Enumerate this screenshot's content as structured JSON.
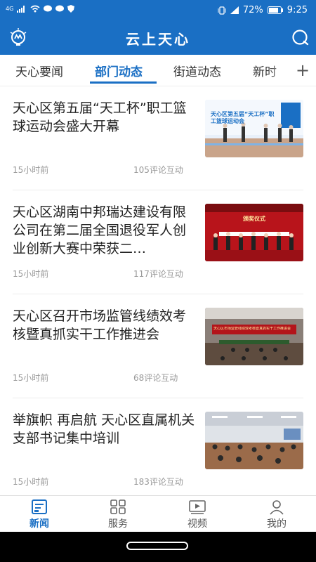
{
  "status_bar": {
    "network": "4G",
    "battery": "72%",
    "time": "9:25"
  },
  "header": {
    "title": "云上天心",
    "left_icon": "lightbulb-logo-icon",
    "right_icon": "chat-bubble-icon"
  },
  "tabs": [
    {
      "label": "天心要闻",
      "active": false
    },
    {
      "label": "部门动态",
      "active": true
    },
    {
      "label": "街道动态",
      "active": false
    },
    {
      "label": "新时",
      "active": false
    }
  ],
  "tab_add_label": "+",
  "news": [
    {
      "title": "天心区第五届“天工杯”职工篮球运动会盛大开幕",
      "time": "15小时前",
      "comments": "105评论互动",
      "thumb_text": "天心区第五届“天工杯”职工篮球运动会"
    },
    {
      "title": "天心区湖南中邦瑞达建设有限公司在第二届全国退役军人创业创新大赛中荣获二…",
      "time": "15小时前",
      "comments": "117评论互动",
      "thumb_text": "颁奖仪式"
    },
    {
      "title": "天心区召开市场监管线绩效考核暨真抓实干工作推进会",
      "time": "15小时前",
      "comments": "68评论互动",
      "thumb_text": "天心区市场监管线绩效考核暨真抓实干工作推进会"
    },
    {
      "title": "举旗帜 再启航 天心区直属机关支部书记集中培训",
      "time": "15小时前",
      "comments": "183评论互动",
      "thumb_text": ""
    }
  ],
  "bottom_nav": [
    {
      "label": "新闻",
      "icon": "news-icon",
      "active": true
    },
    {
      "label": "服务",
      "icon": "grid-icon",
      "active": false
    },
    {
      "label": "视频",
      "icon": "video-icon",
      "active": false
    },
    {
      "label": "我的",
      "icon": "person-icon",
      "active": false
    }
  ],
  "colors": {
    "brand": "#1a6fc4",
    "meta_text": "#999999"
  }
}
